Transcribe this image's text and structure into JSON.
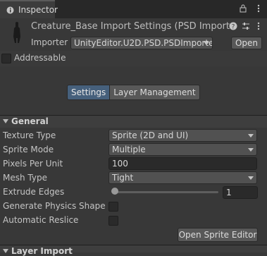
{
  "tab": {
    "title": "Inspector"
  },
  "header": {
    "title": "Creature_Base Import Settings (PSD Importer",
    "importer_label": "Importer",
    "importer_value": "UnityEditor.U2D.PSD.PSDImporte",
    "open_button": "Open"
  },
  "addressable": {
    "label": "Addressable",
    "checked": false
  },
  "toolbar": {
    "settings": "Settings",
    "layer_management": "Layer Management"
  },
  "general": {
    "title": "General",
    "fields": {
      "texture_type": {
        "label": "Texture Type",
        "value": "Sprite (2D and UI)"
      },
      "sprite_mode": {
        "label": "Sprite Mode",
        "value": "Multiple"
      },
      "pixels_per_unit": {
        "label": "Pixels Per Unit",
        "value": "100"
      },
      "mesh_type": {
        "label": "Mesh Type",
        "value": "Tight"
      },
      "extrude_edges": {
        "label": "Extrude Edges",
        "value": "1"
      },
      "generate_physics_shape": {
        "label": "Generate Physics Shape",
        "checked": false
      },
      "automatic_reslice": {
        "label": "Automatic Reslice",
        "checked": false
      }
    },
    "open_sprite_editor": "Open Sprite Editor"
  },
  "layer_import": {
    "title": "Layer Import"
  },
  "colors": {
    "background": "#383838",
    "active_tab": "#46607c"
  }
}
